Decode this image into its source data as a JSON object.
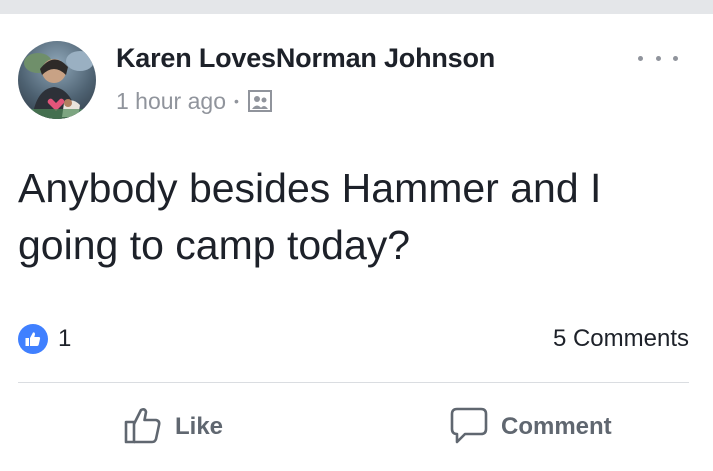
{
  "post": {
    "author": "Karen LovesNorman Johnson",
    "timestamp": "1 hour ago",
    "separator": "•",
    "privacy_icon": "friends-photo-icon",
    "text": "Anybody besides Hammer and I going to camp today?"
  },
  "stats": {
    "reaction_count": "1",
    "comments_label": "5 Comments"
  },
  "actions": {
    "like_label": "Like",
    "comment_label": "Comment"
  },
  "colors": {
    "like_blue": "#4080ff",
    "meta_gray": "#90949c",
    "action_gray": "#606770",
    "text_dark": "#1d2129"
  }
}
